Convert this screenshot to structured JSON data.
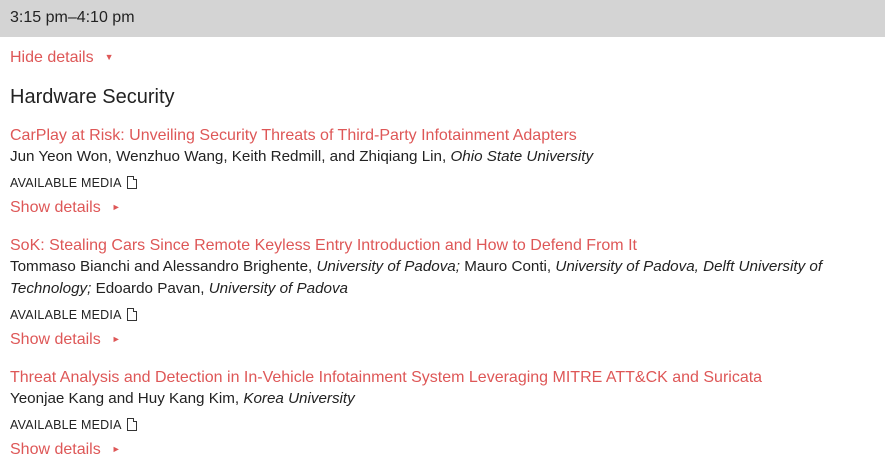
{
  "session": {
    "time": "3:15 pm–4:10 pm",
    "hide_details": "Hide details",
    "title": "Hardware Security"
  },
  "papers": [
    {
      "title": "CarPlay at Risk: Unveiling Security Threats of Third-Party Infotainment Adapters",
      "authors": [
        {
          "text": "Jun Yeon Won, Wenzhuo Wang, Keith Redmill, and Zhiqiang Lin, ",
          "italic": false
        },
        {
          "text": "Ohio State University",
          "italic": true
        }
      ],
      "media_label": "AVAILABLE MEDIA",
      "show_details": "Show details"
    },
    {
      "title": "SoK: Stealing Cars Since Remote Keyless Entry Introduction and How to Defend From It",
      "authors": [
        {
          "text": "Tommaso Bianchi and Alessandro Brighente, ",
          "italic": false
        },
        {
          "text": "University of Padova;",
          "italic": true
        },
        {
          "text": " Mauro Conti, ",
          "italic": false
        },
        {
          "text": "University of Padova, Delft University of Technology;",
          "italic": true
        },
        {
          "text": " Edoardo Pavan, ",
          "italic": false
        },
        {
          "text": "University of Padova",
          "italic": true
        }
      ],
      "media_label": "AVAILABLE MEDIA",
      "show_details": "Show details"
    },
    {
      "title": "Threat Analysis and Detection in In-Vehicle Infotainment System Leveraging MITRE ATT&CK and Suricata",
      "authors": [
        {
          "text": "Yeonjae Kang and Huy Kang Kim, ",
          "italic": false
        },
        {
          "text": "Korea University",
          "italic": true
        }
      ],
      "media_label": "AVAILABLE MEDIA",
      "show_details": "Show details"
    }
  ],
  "icons": {
    "toggle_arrow_down": "▼",
    "toggle_arrow_right": "►",
    "media_icon": "document-icon"
  },
  "colors": {
    "header_bg": "#d4d4d4",
    "link": "#de5757",
    "text": "#222222"
  }
}
